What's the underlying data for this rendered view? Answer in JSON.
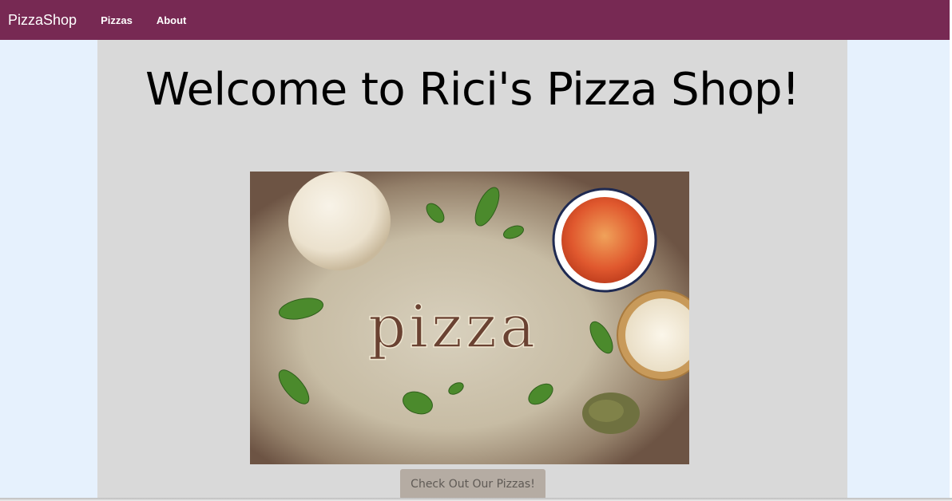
{
  "navbar": {
    "brand": "PizzaShop",
    "links": [
      {
        "label": "Pizzas"
      },
      {
        "label": "About"
      }
    ],
    "color": "#772953"
  },
  "main": {
    "title": "Welcome to Rici's Pizza Shop!",
    "hero_image": {
      "word": "pizza",
      "icon": "pizza-ingredients-photo"
    },
    "cta_label": "Check Out Our Pizzas!"
  }
}
